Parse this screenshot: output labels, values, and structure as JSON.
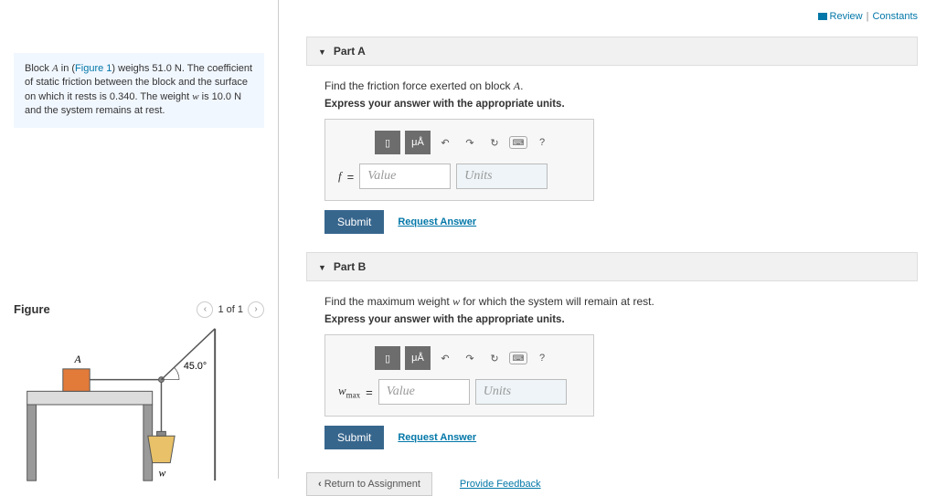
{
  "top": {
    "review": "Review",
    "constants": "Constants"
  },
  "prompt": {
    "text_pre": "Block ",
    "text_blockA": "A",
    "text_mid1": " in (",
    "figure_link": "Figure 1",
    "text_mid2": ") weighs 51.0 N. The coefficient of static friction between the block and the surface on which it rests is 0.340. The weight ",
    "text_w": "w",
    "text_end": " is 10.0 N and the system remains at rest."
  },
  "figure": {
    "title": "Figure",
    "pager": "1 of 1",
    "labelA": "A",
    "angle": "45.0°",
    "labelW": "w"
  },
  "partA": {
    "header": "Part A",
    "question_pre": "Find the friction force exerted on block ",
    "question_var": "A",
    "question_post": ".",
    "instruction": "Express your answer with the appropriate units.",
    "var": "f",
    "eq": "=",
    "value_ph": "Value",
    "units_ph": "Units",
    "submit": "Submit",
    "request": "Request Answer"
  },
  "partB": {
    "header": "Part B",
    "question_pre": "Find the maximum weight ",
    "question_var": "w",
    "question_post": " for which the system will remain at rest.",
    "instruction": "Express your answer with the appropriate units.",
    "var": "w",
    "var_sub": "max",
    "eq": "=",
    "value_ph": "Value",
    "units_ph": "Units",
    "submit": "Submit",
    "request": "Request Answer"
  },
  "tools": {
    "templates": "▯",
    "micro": "μÅ",
    "undo": "↶",
    "redo": "↷",
    "reset": "↻",
    "keyboard": "⌨",
    "help": "?"
  },
  "bottom": {
    "return": "Return to Assignment",
    "feedback": "Provide Feedback"
  }
}
